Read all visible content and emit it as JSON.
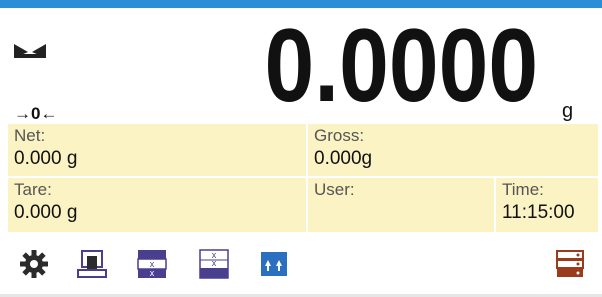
{
  "display": {
    "stability_indicator": "stable-icon",
    "zero_indicator": "→0←",
    "main_value": "0.0000",
    "unit": "g"
  },
  "info": {
    "net_label": "Net:",
    "net_value": "0.000 g",
    "gross_label": "Gross:",
    "gross_value": "0.000g",
    "tare_label": "Tare:",
    "tare_value": "0.000 g",
    "user_label": "User:",
    "user_value": "",
    "time_label": "Time:",
    "time_value": "11:15:00"
  },
  "toolbar": {
    "items": [
      "gear-icon",
      "tare-icon",
      "checkweighing-icon",
      "limits-icon",
      "increment-icon",
      "database-icon"
    ]
  },
  "colors": {
    "info_bg": "#fbf3c4",
    "topbar": "#2a8fd6",
    "icon_purple": "#4a3f8f",
    "icon_blue": "#2a6fc0",
    "icon_brown": "#9b3b1c"
  }
}
